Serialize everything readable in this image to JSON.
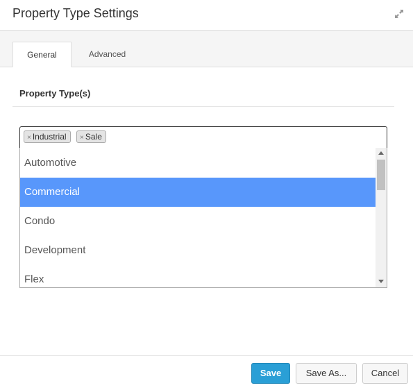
{
  "dialog": {
    "title": "Property Type Settings",
    "expand_icon": "expand-arrows-icon"
  },
  "tabs": [
    {
      "label": "General",
      "active": true
    },
    {
      "label": "Advanced",
      "active": false
    }
  ],
  "section": {
    "title": "Property Type(s)"
  },
  "select": {
    "selected": [
      {
        "remove_glyph": "×",
        "label": "Industrial"
      },
      {
        "remove_glyph": "×",
        "label": "Sale"
      }
    ],
    "options": [
      {
        "label": "Automotive",
        "highlighted": false
      },
      {
        "label": "Commercial",
        "highlighted": true
      },
      {
        "label": "Condo",
        "highlighted": false
      },
      {
        "label": "Development",
        "highlighted": false
      },
      {
        "label": "Flex",
        "highlighted": false
      }
    ],
    "highlight_color": "#5897fb"
  },
  "footer": {
    "save_label": "Save",
    "save_as_label": "Save As...",
    "cancel_label": "Cancel",
    "primary_color": "#2a9fd6"
  }
}
